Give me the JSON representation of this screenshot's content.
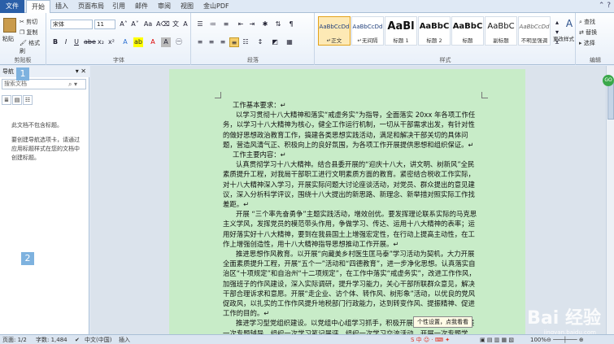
{
  "tabs": [
    "文件",
    "开始",
    "插入",
    "页面布局",
    "引用",
    "邮件",
    "审阅",
    "视图",
    "金山PDF"
  ],
  "clipboard": {
    "paste": "粘贴",
    "cut": "剪切",
    "copy": "复制",
    "format_painter": "格式刷",
    "label": "剪贴板"
  },
  "font": {
    "name": "宋体",
    "size": "11",
    "label": "字体"
  },
  "paragraph": {
    "label": "段落"
  },
  "styles": {
    "label": "样式",
    "items": [
      {
        "sample": "AaBbCcDd",
        "name": "↵正文"
      },
      {
        "sample": "AaBbCcDd",
        "name": "↵无间隔"
      },
      {
        "sample": "AaBl",
        "name": "标题 1"
      },
      {
        "sample": "AaBbC",
        "name": "标题 2"
      },
      {
        "sample": "AaBbC",
        "name": "标题"
      },
      {
        "sample": "AaBbC",
        "name": "副标题"
      },
      {
        "sample": "AaBbCcDd",
        "name": "不明显强调"
      }
    ],
    "change_styles": "更改样式"
  },
  "editing": {
    "find": "查找",
    "replace": "替换",
    "select": "选择",
    "label": "编辑"
  },
  "nav": {
    "title": "导航",
    "search_placeholder": "搜索文档",
    "no_headings": "此文档不包含标题。",
    "hint": "要创建导航选项卡，请通过应用标题样式在您的文档中创建标题。"
  },
  "badges": [
    "1",
    "2"
  ],
  "document": {
    "paragraphs": [
      {
        "text": "工作基本要求：↵",
        "indent": false
      },
      {
        "text": "以学习贯彻十八大精神和落实“戒虚务实”为指导，全面落实 20xx 年各项工作任务，以学习十八大精神为核心，健全工作运行机制，一切从干部需求出发，有针对性的做好思想政治教育工作，搞建各类思想实践活动，满足和解决干部关切的具体问题，营造风清气正、积极向上的良好氛围，为各项工作开展提供思想和组织保证。↵",
        "indent": true
      },
      {
        "text": "工作主要内容：↵",
        "indent": false
      },
      {
        "text": "认真贯彻学习十八大精神。结合县委开展的“迎庆十八大，讲文明、树新风”全民素质提升工程，对我局干部职工进行文明素质方面的教育。紧密结合税收工作实际，对十八大精神深入学习，开展实际问题大讨论座谈活动，对党员、群众提出的意见建议，深入分析科学评议，围绕十八大提出的新思路、新理念、新举措对照实际工作找差距。↵",
        "indent": true
      },
      {
        "text": "开展 “三个率先奋勇争”主题实践活动，增效创优。要发挥理论联系实际的马克思主义学风，发挥党员的模范带头作用，争做学习、传达、运用十八大精神的表率；运用好落实好十八大精神，要到在我县国土上增强宏定性，在行动上提高主动性，在工作上增强创造性，用十八大精神指导思想推动工作开展。↵",
        "indent": true
      },
      {
        "text": "推进思想作风教育。以开展“向藏美乡村医生匡马泰”学习活动为契机，大力开展全面素质提升工程，开展“五个一”活动和“四德教育”，进一步净化思想。认真落实自治区“十项规定”和自治州“十二项规定”，在工作中落实“戒虚务实”，改进工作作风，加强班子的作风建设，深入实际调研，提升学习能力，关心干部所联群众意见，解决干部合理诉求和意愿。开展“走企业、访个体、转作风、树形象”活动，以优良的党风促政风，以扎实的工作作风提升地税部门行政能力，达到转变作风、提振精神、促进工作的目的。↵",
        "indent": true
      },
      {
        "text": "推进学习型党组织建设。以党组中心组学习抓手，积极开展学习活动，每月开展一次专题辅导、组织一次学习笔记展评、组织一次学习交流活动，开展一次专题学习。",
        "indent": true
      }
    ]
  },
  "tooltip": "个性设置，点我看看",
  "status": {
    "page": "页面: 1/2",
    "words": "字数: 1,484",
    "lang": "中文(中国)",
    "mode": "插入",
    "zoom": "100%"
  },
  "watermark": {
    "main": "Bai 经验",
    "sub": "jingyan.baidu.com"
  }
}
